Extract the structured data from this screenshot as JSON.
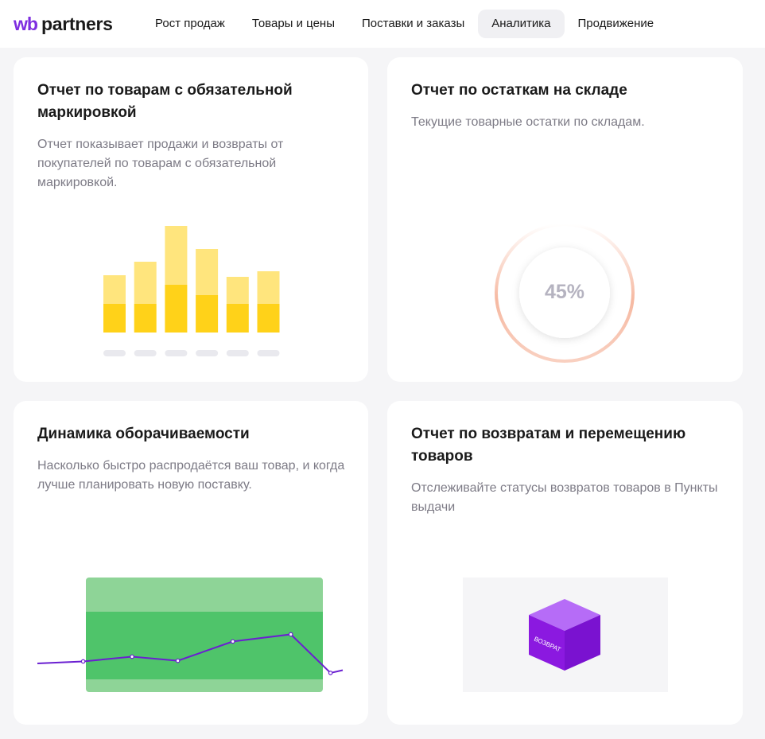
{
  "header": {
    "logo": {
      "wb": "wb",
      "partners": "partners"
    },
    "nav": [
      {
        "label": "Рост продаж",
        "active": false
      },
      {
        "label": "Товары и цены",
        "active": false
      },
      {
        "label": "Поставки и заказы",
        "active": false
      },
      {
        "label": "Аналитика",
        "active": true
      },
      {
        "label": "Продвижение",
        "active": false
      }
    ]
  },
  "cards": [
    {
      "title": "Отчет по товарам с обязательной маркировкой",
      "description": "Отчет показывает продажи и возвраты от покупателей по товарам с обязательной маркировкой."
    },
    {
      "title": "Отчет по остаткам на складе",
      "description": "Текущие товарные остатки по складам.",
      "progress_label": "45%",
      "progress_value": 45
    },
    {
      "title": "Динамика оборачиваемости",
      "description": "Насколько быстро распродаётся ваш товар, и когда лучше планировать новую поставку."
    },
    {
      "title": "Отчет по возвратам и перемещению товаров",
      "description": "Отслеживайте статусы возвратов товаров в Пункты выдачи",
      "box_label": "ВОЗВРАТ"
    }
  ],
  "illustrations": {
    "stacked_bars": {
      "bottom": [
        36,
        36,
        60,
        47,
        36,
        36
      ],
      "top": [
        36,
        53,
        74,
        58,
        34,
        41
      ],
      "colors": {
        "bottom": "#ffd219",
        "top": "#ffe57d",
        "placeholder": "#e9e9ee"
      }
    },
    "turnover_line": {
      "points": [
        [
          0,
          0.53
        ],
        [
          0.15,
          0.47
        ],
        [
          0.31,
          0.33
        ],
        [
          0.46,
          0.45
        ],
        [
          0.64,
          -0.12
        ],
        [
          0.83,
          -0.33
        ],
        [
          0.96,
          0.81
        ],
        [
          1.0,
          0.73
        ]
      ],
      "colors": {
        "band_outer": "#8ed497",
        "band_inner": "#4fc46a",
        "line": "#6a1fd1"
      }
    },
    "colors": {
      "ring": "#f5b197",
      "box_front": "#8b19e0",
      "box_top": "#b66cf7",
      "box_side": "#7a12d0",
      "box_bg": "#f5f5f7"
    }
  }
}
